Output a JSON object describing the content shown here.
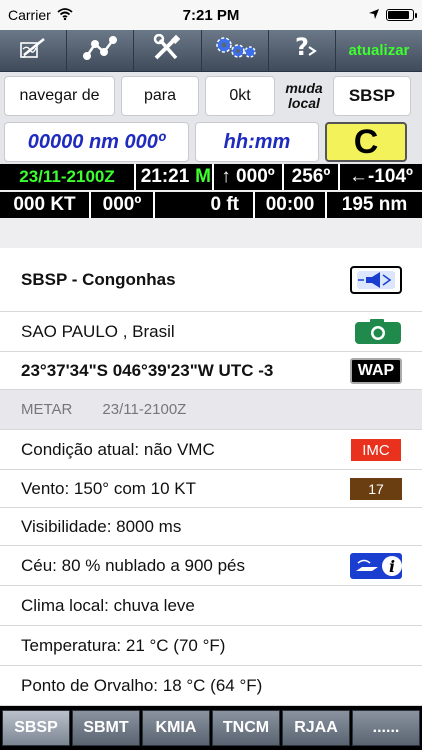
{
  "status": {
    "carrier": "Carrier",
    "time": "7:21 PM"
  },
  "toolbar": {
    "update_label": "atualizar"
  },
  "inputs": {
    "navigate_from": "navegar de",
    "to": "para",
    "speed": "0kt",
    "change_local": "muda local",
    "airport": "SBSP",
    "distance_bearing": "00000 nm 000º",
    "time_field": "hh:mm",
    "c_button": "C"
  },
  "row1": {
    "datetime": "23/11-2100Z",
    "clock": "21:21",
    "mode": "M",
    "heading": "↑ 000º",
    "wind_dir": "256º",
    "wind": "←-104º"
  },
  "row2": {
    "speed": "000 KT",
    "course": "000º",
    "altitude": "0 ft",
    "elapsed": "00:00",
    "distance": "195 nm"
  },
  "info": {
    "airport_name": "SBSP - Congonhas",
    "city": "SAO PAULO , Brasil",
    "coords": "23°37'34\"S   046°39'23\"W   UTC -3",
    "wap_label": "WAP",
    "metar_label": "METAR",
    "metar_time": "23/11-2100Z",
    "condition": "Condição atual: não VMC",
    "condition_badge": "IMC",
    "wind": "Vento:  150° com 10 KT",
    "wind_badge": "17",
    "visibility": "Visibilidade: 8000 ms",
    "sky": "Céu: 80 % nublado a   900 pés",
    "weather": "Clima local: chuva leve",
    "temperature": "Temperatura: 21 °C (70 °F)",
    "dew_point": "Ponto de Orvalho: 18 °C (64 °F)"
  },
  "tabs": [
    "SBSP",
    "SBMT",
    "KMIA",
    "TNCM",
    "RJAA",
    "......"
  ],
  "colors": {
    "accent_green": "#3dff2f",
    "imc_red": "#e8321e",
    "wind_brown": "#6b3e12",
    "field_blue": "#1f2bbf"
  }
}
